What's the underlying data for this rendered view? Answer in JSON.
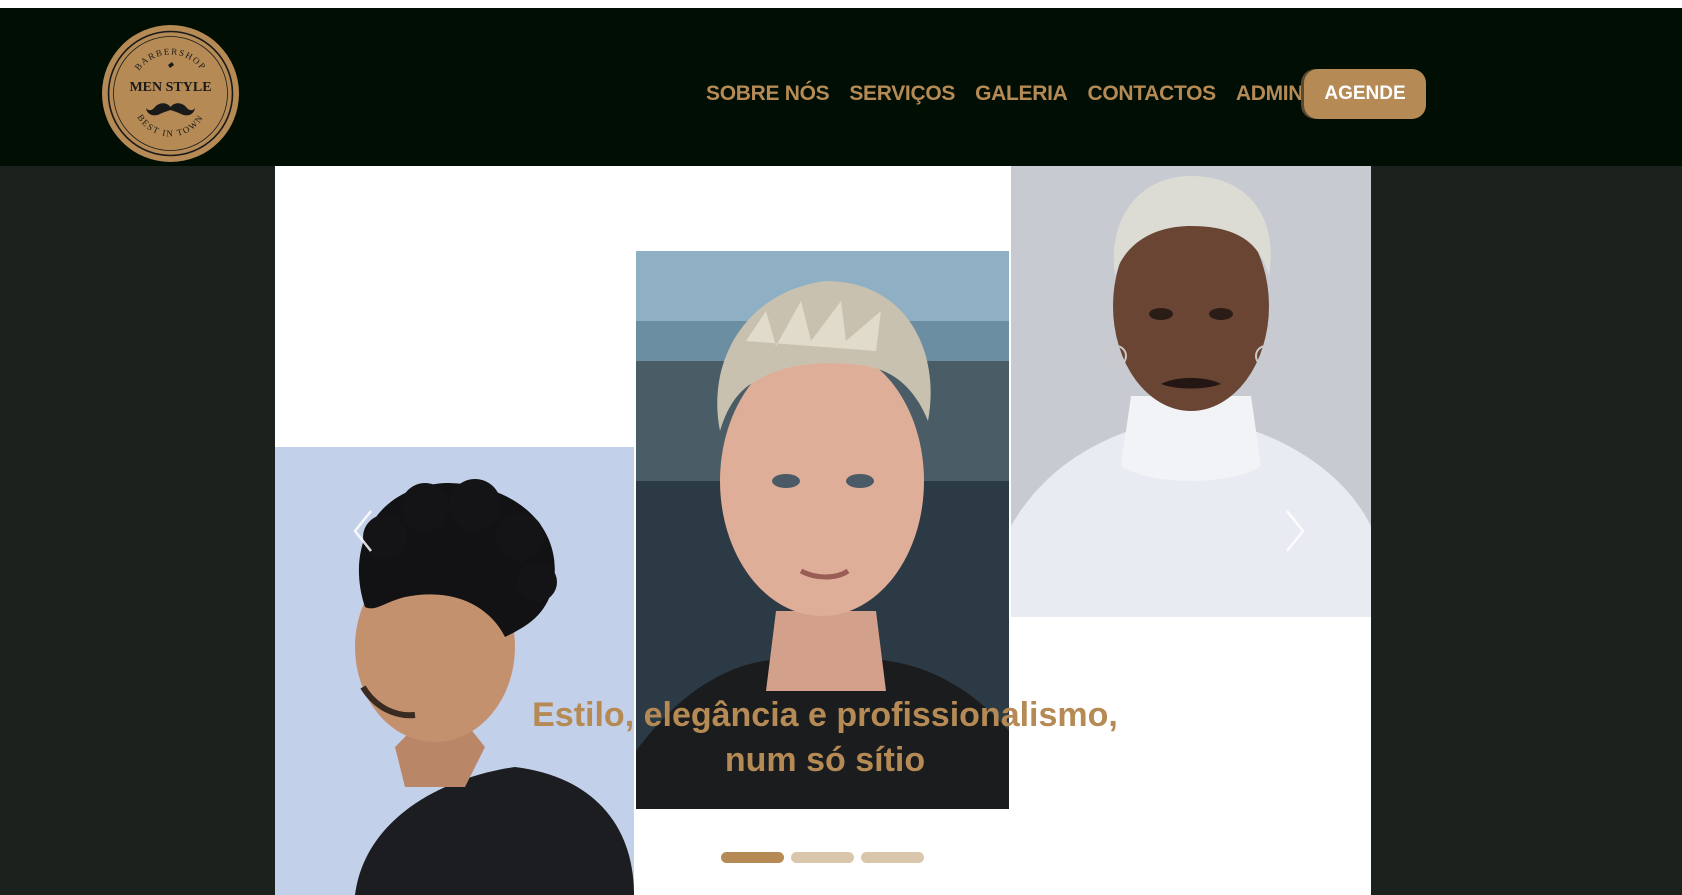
{
  "brand": {
    "logo_top_text": "BARBERSHOP",
    "logo_name": "MEN STYLE",
    "logo_bottom_text": "BEST IN TOWN"
  },
  "nav": {
    "items": [
      {
        "label": "SOBRE NÓS"
      },
      {
        "label": "SERVIÇOS"
      },
      {
        "label": "GALERIA"
      },
      {
        "label": "CONTACTOS"
      },
      {
        "label": "ADMIN"
      }
    ],
    "cta_label": "AGENDE"
  },
  "hero": {
    "caption_line1": "Estilo, elegância e profissionalismo,",
    "caption_line2": "num só sítio",
    "slides": [
      {
        "icon": "photo-curly-fade-profile"
      },
      {
        "icon": "photo-blond-textured-crop"
      },
      {
        "icon": "photo-platinum-buzz-turtleneck"
      }
    ],
    "slide_count": 3,
    "active_slide": 1
  },
  "colors": {
    "accent": "#b58a55",
    "navbar_bg": "#000e03",
    "page_bg": "#1b211c",
    "indicator_inactive": "#dac6aa"
  }
}
